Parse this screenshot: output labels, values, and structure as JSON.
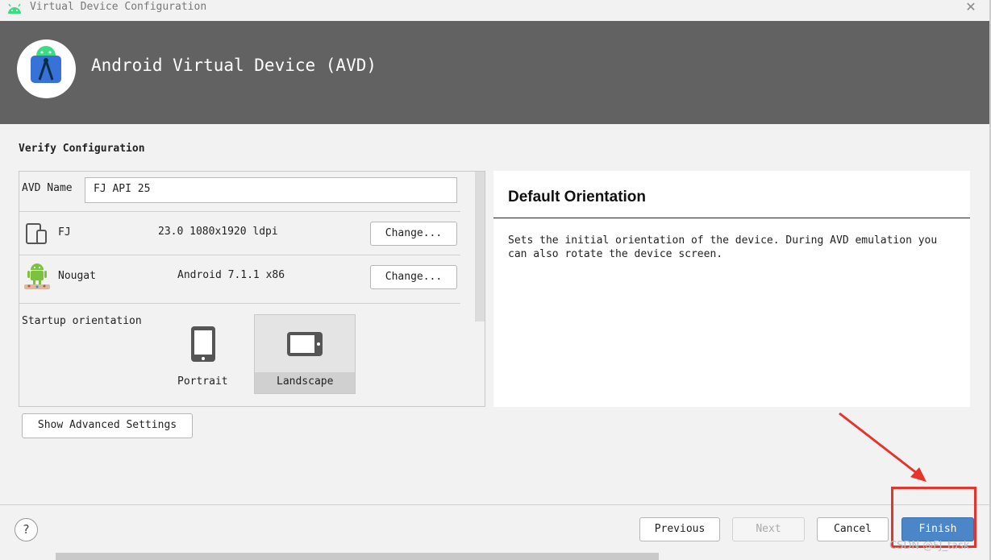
{
  "window": {
    "title": "Virtual Device Configuration",
    "close_icon": "close-icon"
  },
  "header": {
    "title": "Android Virtual Device (AVD)"
  },
  "section": {
    "title": "Verify Configuration"
  },
  "form": {
    "avd_name_label": "AVD Name",
    "avd_name_value": "FJ API 25",
    "device": {
      "name": "FJ",
      "spec": "23.0 1080x1920 ldpi",
      "change_label": "Change..."
    },
    "system_image": {
      "name": "Nougat",
      "spec": "Android 7.1.1 x86",
      "change_label": "Change..."
    },
    "orientation": {
      "label": "Startup orientation",
      "options": [
        "Portrait",
        "Landscape"
      ],
      "selected": "Landscape"
    }
  },
  "advanced_button": {
    "label": "Show Advanced Settings"
  },
  "help": {
    "title": "Default Orientation",
    "body": "Sets the initial orientation of the device. During AVD emulation you can also rotate the device screen."
  },
  "footer": {
    "help_label": "?",
    "buttons": {
      "previous": "Previous",
      "next": "Next",
      "cancel": "Cancel",
      "finish": "Finish"
    }
  },
  "annotation": {
    "color": "#e4342b"
  },
  "watermark": {
    "text": "CSDN @FJ_task"
  },
  "colors": {
    "header_bg": "#626262",
    "primary_button": "#4a86c8",
    "annotation_red": "#e4342b"
  }
}
